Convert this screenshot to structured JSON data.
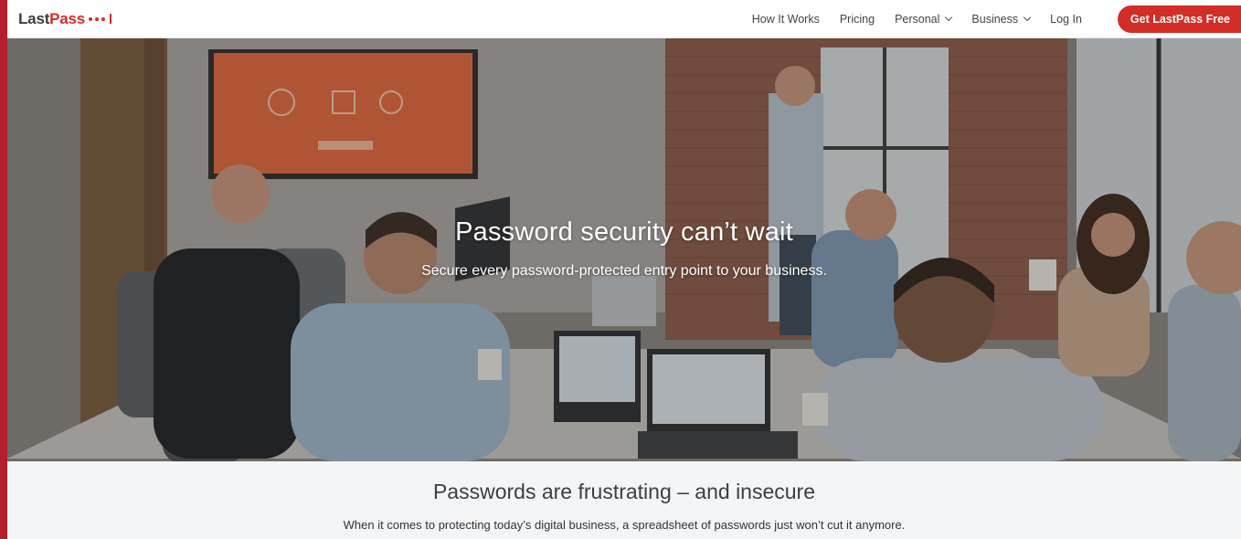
{
  "brand": {
    "name_part1": "Last",
    "name_part2": "Pass",
    "primary_color": "#d32d27",
    "rail_color": "#b41f2d"
  },
  "nav": {
    "items": [
      {
        "label": "How It Works",
        "dropdown": false
      },
      {
        "label": "Pricing",
        "dropdown": false
      },
      {
        "label": "Personal",
        "dropdown": true
      },
      {
        "label": "Business",
        "dropdown": true
      },
      {
        "label": "Log In",
        "dropdown": false
      }
    ],
    "cta_label": "Get LastPass Free"
  },
  "hero": {
    "title": "Password security can’t wait",
    "subtitle": "Secure every password-protected entry point to your business.",
    "image_description": "team meeting in conference room with laptops and wall display"
  },
  "section": {
    "title": "Passwords are frustrating – and insecure",
    "subtitle": "When it comes to protecting today’s digital business, a spreadsheet of passwords just won’t cut it anymore."
  }
}
